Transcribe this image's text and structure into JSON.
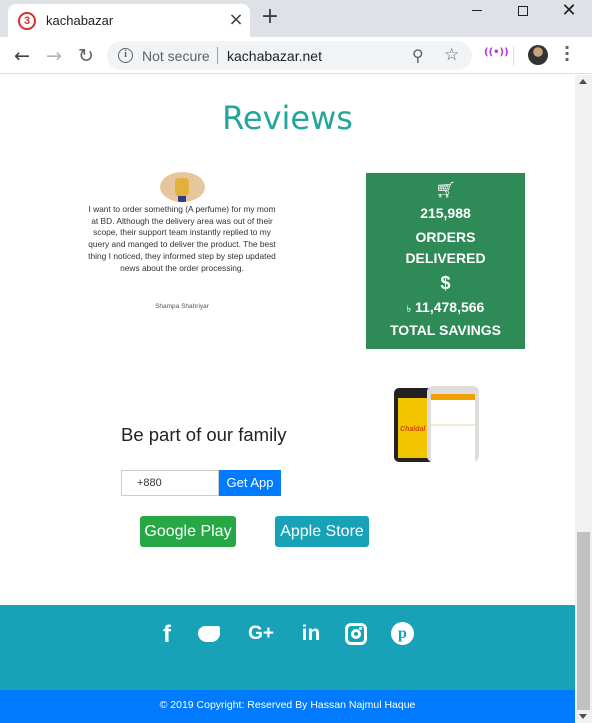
{
  "browser": {
    "tab_title": "kachabazar",
    "tab_favicon": "3",
    "new_tab_label": "+",
    "close_tab_label": "×",
    "security_label": "Not secure",
    "url": "kachabazar.net"
  },
  "reviews": {
    "title": "Reviews",
    "text": "I want to order something (A perfume) for my mom at BD. Although the delivery area was out of their scope, their support team instantly replied to my query and manged to deliver the product. The best thing I noticed, they informed step by step updated news about the order processing.",
    "author": "Shampa Shahriyar"
  },
  "stats": {
    "orders_count": "215,988",
    "orders_label": "ORDERS DELIVERED",
    "dollar_symbol": "$",
    "currency_symbol": "৳",
    "savings_amount": "11,478,566",
    "savings_label": "TOTAL SAVINGS"
  },
  "app_promo": {
    "title": "Be part of our family",
    "phone_value": "+880",
    "get_app_label": "Get App",
    "google_play_label": "Google Play",
    "apple_store_label": "Apple Store",
    "phone_logo_text": "Chaldal"
  },
  "footer": {
    "social_icons": [
      "facebook-icon",
      "twitter-icon",
      "google-plus-icon",
      "linkedin-icon",
      "instagram-icon",
      "pinterest-icon"
    ],
    "facebook_glyph": "f",
    "google_plus_glyph": "G+",
    "linkedin_glyph": "in",
    "pinterest_glyph": "p",
    "copyright": "© 2019 Copyright: Reserved By Hassan Najmul Haque"
  },
  "colors": {
    "heading_teal": "#26a69a",
    "stats_green": "#2e8b57",
    "footer_teal": "#17a2b8",
    "copyright_blue": "#007bff",
    "google_play_green": "#28a745"
  }
}
